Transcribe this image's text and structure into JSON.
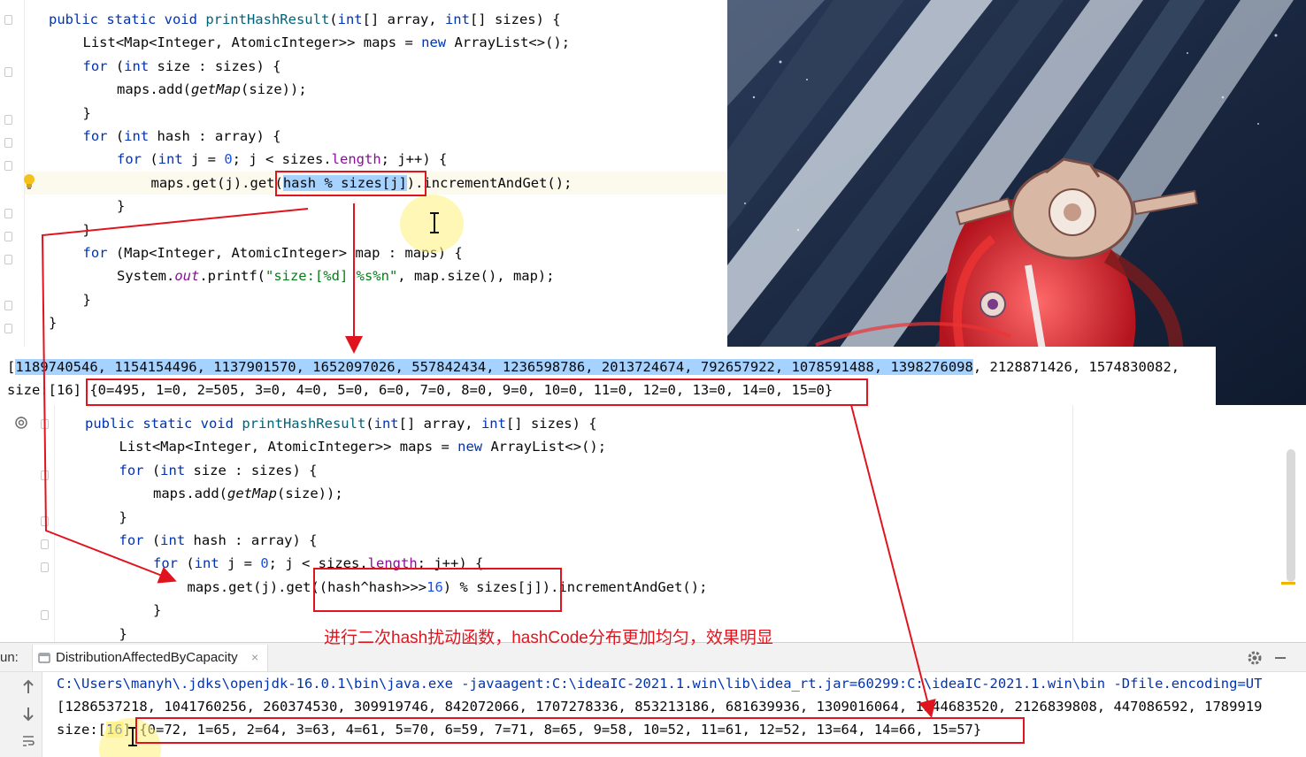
{
  "top_editor": {
    "lines": [
      {
        "segments": [
          [
            "kw",
            "public static void "
          ],
          [
            "fn",
            "printHashResult"
          ],
          [
            "",
            "("
          ],
          [
            "kw",
            "int"
          ],
          [
            "",
            "[] array, "
          ],
          [
            "kw",
            "int"
          ],
          [
            "",
            "[] sizes) {"
          ]
        ]
      },
      {
        "segments": [
          [
            "",
            "List<Map<Integer, AtomicInteger>> maps = "
          ],
          [
            "kw",
            "new "
          ],
          [
            "",
            "ArrayList<>();"
          ]
        ]
      },
      {
        "segments": [
          [
            "kw",
            "for "
          ],
          [
            "",
            "("
          ],
          [
            "kw",
            "int "
          ],
          [
            "",
            "size : sizes) {"
          ]
        ]
      },
      {
        "segments": [
          [
            "",
            "maps.add("
          ],
          [
            "ital",
            "getMap"
          ],
          [
            "",
            "(size));"
          ]
        ]
      },
      {
        "segments": [
          [
            "",
            "}"
          ]
        ]
      },
      {
        "segments": [
          [
            "kw",
            "for "
          ],
          [
            "",
            "("
          ],
          [
            "kw",
            "int "
          ],
          [
            "",
            "hash : array) {"
          ]
        ]
      },
      {
        "segments": [
          [
            "kw",
            "for "
          ],
          [
            "",
            "("
          ],
          [
            "kw",
            "int "
          ],
          [
            "",
            "j = "
          ],
          [
            "num",
            "0"
          ],
          [
            "",
            "; j < sizes."
          ],
          [
            "fld",
            "length"
          ],
          [
            "",
            "; j++) {"
          ]
        ]
      },
      {
        "segments": [
          [
            "",
            "maps.get(j).get("
          ],
          [
            "sel",
            "hash % sizes[j]"
          ],
          [
            "",
            ").incrementAndGet();"
          ]
        ]
      },
      {
        "segments": [
          [
            "",
            "}"
          ]
        ]
      },
      {
        "segments": [
          [
            "",
            "}"
          ]
        ]
      },
      {
        "segments": [
          [
            "kw",
            "for "
          ],
          [
            "",
            "(Map<Integer, AtomicInteger> map : maps) {"
          ]
        ]
      },
      {
        "segments": [
          [
            "",
            "System."
          ],
          [
            "stat",
            "out"
          ],
          [
            "",
            ".printf("
          ],
          [
            "str",
            "\"size:[%d] %s%n\""
          ],
          [
            "",
            ", map.size(), map);"
          ]
        ]
      },
      {
        "segments": [
          [
            "",
            "}"
          ]
        ]
      },
      {
        "segments": [
          [
            "",
            "}"
          ]
        ]
      }
    ]
  },
  "mid_output": {
    "line1_selected": "1189740546, 1154154496, 1137901570, 1652097026, 557842434, 1236598786, 2013724674, 792657922, 1078591488, 1398276098",
    "line1_prefix": "[",
    "line1_rest": ", 2128871426, 1574830082,",
    "line2_prefix": "size:[16] ",
    "line2_map": "{0=495, 1=0, 2=505, 3=0, 4=0, 5=0, 6=0, 7=0, 8=0, 9=0, 10=0, 11=0, 12=0, 13=0, 14=0, 15=0}"
  },
  "bottom_editor": {
    "lines": [
      {
        "segments": [
          [
            "kw",
            "public static void "
          ],
          [
            "fn",
            "printHashResult"
          ],
          [
            "",
            "("
          ],
          [
            "kw",
            "int"
          ],
          [
            "",
            "[] array, "
          ],
          [
            "kw",
            "int"
          ],
          [
            "",
            "[] sizes) {"
          ]
        ]
      },
      {
        "segments": [
          [
            "",
            "List<Map<Integer, AtomicInteger>> maps = "
          ],
          [
            "kw",
            "new "
          ],
          [
            "",
            "ArrayList<>();"
          ]
        ]
      },
      {
        "segments": [
          [
            "kw",
            "for "
          ],
          [
            "",
            "("
          ],
          [
            "kw",
            "int "
          ],
          [
            "",
            "size : sizes) {"
          ]
        ]
      },
      {
        "segments": [
          [
            "",
            "maps.add("
          ],
          [
            "ital",
            "getMap"
          ],
          [
            "",
            "(size));"
          ]
        ]
      },
      {
        "segments": [
          [
            "",
            "}"
          ]
        ]
      },
      {
        "segments": [
          [
            "kw",
            "for "
          ],
          [
            "",
            "("
          ],
          [
            "kw",
            "int "
          ],
          [
            "",
            "hash : array) {"
          ]
        ]
      },
      {
        "segments": [
          [
            "kw",
            "for "
          ],
          [
            "",
            "("
          ],
          [
            "kw",
            "int "
          ],
          [
            "",
            "j = "
          ],
          [
            "num",
            "0"
          ],
          [
            "",
            "; j < sizes."
          ],
          [
            "fld",
            "length"
          ],
          [
            "",
            "; j++) {"
          ]
        ]
      },
      {
        "segments": [
          [
            "",
            "maps.get(j).get((hash^hash>>>"
          ],
          [
            "num",
            "16"
          ],
          [
            "",
            ") % sizes[j]).incrementAndGet();"
          ]
        ]
      },
      {
        "segments": [
          [
            "",
            "}"
          ]
        ]
      },
      {
        "segments": [
          [
            "",
            "}"
          ]
        ]
      }
    ]
  },
  "annotation_text": "进行二次hash扰动函数，hashCode分布更加均匀，效果明显",
  "run_panel": {
    "label": "un:",
    "tab_title": "DistributionAffectedByCapacity",
    "console": {
      "line1": "C:\\Users\\manyh\\.jdks\\openjdk-16.0.1\\bin\\java.exe -javaagent:C:\\ideaIC-2021.1.win\\lib\\idea_rt.jar=60299:C:\\ideaIC-2021.1.win\\bin -Dfile.encoding=UT",
      "line2": "[1286537218, 1041760256, 260374530, 309919746, 842072066, 1707278336, 853213186, 681639936, 1309016064, 1544683520, 2126839808, 447086592, 1789919",
      "line3_prefix": "size:[",
      "line3_num": "16",
      "line3_close": "] ",
      "line3_map": "{0=72, 1=65, 2=64, 3=63, 4=61, 5=70, 6=59, 7=71, 8=65, 9=58, 10=52, 11=61, 12=52, 13=64, 14=66, 15=57}"
    }
  },
  "colors": {
    "keyword": "#0033b3",
    "method": "#00627a",
    "number": "#1750eb",
    "string": "#067d17",
    "field": "#871094",
    "annotation_red": "#e0141e",
    "selection": "#a6d2ff"
  },
  "icons": [
    "bulb-icon",
    "at-icon",
    "gear-icon",
    "minimize-icon",
    "close-icon",
    "arrow-up-icon",
    "arrow-down-icon",
    "wrap-icon",
    "text-cursor-icon"
  ]
}
